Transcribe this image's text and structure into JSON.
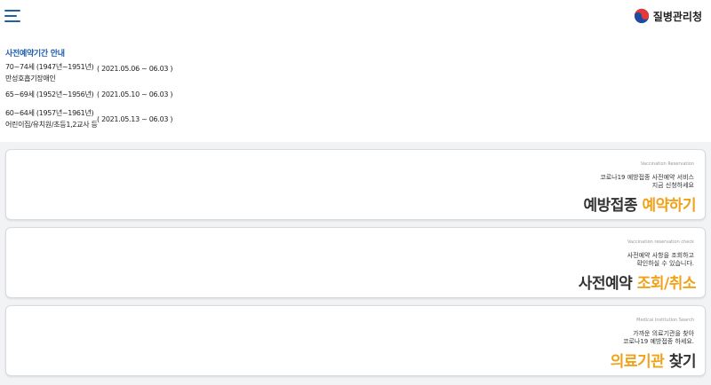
{
  "header": {
    "menu_icon": "hamburger-menu-icon",
    "logo_icon": "taegeuk-emblem-icon",
    "logo_text": "질병관리청"
  },
  "info": {
    "title": "사전예약기간 안내",
    "rows": [
      {
        "line1": "70~74세 (1947년~1951년)",
        "line2": "만성호흡기장애인",
        "period": "( 2021.05.06 ~ 06.03 )"
      },
      {
        "line1": "65~69세 (1952년~1956년)",
        "line2": "",
        "period": "( 2021.05.10 ~ 06.03 )"
      },
      {
        "line1": "60~64세 (1957년~1961년)",
        "line2": "어린이집/유치원/초등1,2교사 등",
        "period": "( 2021.05.13 ~ 06.03 )"
      }
    ]
  },
  "cards": [
    {
      "en": "Vaccination Reservation",
      "desc1": "코로나19 예방접종 사전예약 서비스",
      "desc2": "지금 신청하세요",
      "title_plain": "예방접종 ",
      "title_highlight": "예약하기"
    },
    {
      "en": "Vaccination reservation check",
      "desc1": "사전예약 사항을 조회하고",
      "desc2": "확인하실 수 있습니다.",
      "title_plain": "사전예약 ",
      "title_highlight": "조회/취소"
    },
    {
      "en": "Medical Institution Search",
      "desc1": "가까운 의료기관을 찾아",
      "desc2": "코로나19 예방접종 하세요.",
      "title_highlight": "의료기관",
      "title_plain": " 찾기"
    }
  ],
  "colors": {
    "accent": "#f0a21b",
    "brand": "#1f5fa8",
    "background": "#f2f3f5"
  }
}
